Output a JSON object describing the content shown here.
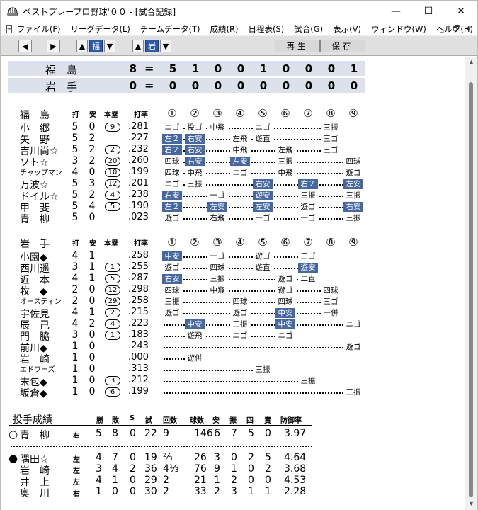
{
  "window": {
    "title": "ベストプレープロ野球'００ - [試合記録]",
    "minimize": "—",
    "maximize": "☐",
    "close": "✕"
  },
  "menu": [
    "ファイル(F)",
    "リーグデータ(L)",
    "チームデータ(T)",
    "成績(R)",
    "日程表(S)",
    "試合(G)",
    "表示(V)",
    "ウィンドウ(W)",
    "ヘルプ(H)"
  ],
  "mdi_controls": [
    "_",
    "🗗",
    "✕"
  ],
  "toolbar": {
    "prev": "◀",
    "next": "▶",
    "team1_up": "▲",
    "team1": "福",
    "team1_down": "▼",
    "team2_up": "▲",
    "team2": "岩",
    "team2_down": "▼",
    "play": "再生",
    "save": "保存"
  },
  "scoreboard": {
    "rows": [
      {
        "team": "福　島",
        "runs": "8",
        "eq": "=",
        "innings": [
          "5",
          "1",
          "0",
          "0",
          "1",
          "0",
          "0",
          "0",
          "1"
        ]
      },
      {
        "team": "岩　手",
        "runs": "0",
        "eq": "=",
        "innings": [
          "0",
          "0",
          "0",
          "0",
          "0",
          "0",
          "0",
          "0",
          "0"
        ]
      }
    ]
  },
  "batting_headers": {
    "ab": "打",
    "h": "安",
    "hr": "本塁",
    "avg": "打率",
    "innings": [
      "①",
      "②",
      "③",
      "④",
      "⑤",
      "⑥",
      "⑦",
      "⑧",
      "⑨"
    ]
  },
  "teams": [
    {
      "name": "福　島",
      "players": [
        {
          "name": "小　郷",
          "ab": "5",
          "h": "0",
          "hr": "9",
          "avg": ".281",
          "res": [
            [
              "ニゴ",
              0
            ],
            [
              "投ゴ",
              0
            ],
            [
              "中飛",
              0
            ],
            [
              "",
              0
            ],
            [
              "ニゴ",
              0
            ],
            [
              "",
              0
            ],
            [
              "",
              0
            ],
            [
              "三振",
              0
            ],
            [
              "",
              0
            ]
          ]
        },
        {
          "name": "矢　野",
          "ab": "5",
          "h": "2",
          "hr": "",
          "avg": ".227",
          "res": [
            [
              "左２",
              1
            ],
            [
              "右安",
              1
            ],
            [
              "",
              0
            ],
            [
              "左飛",
              0
            ],
            [
              "遊直",
              0
            ],
            [
              "",
              0
            ],
            [
              "",
              0
            ],
            [
              "三ゴ",
              0
            ],
            [
              "",
              0
            ]
          ]
        },
        {
          "name": "吉川尚☆",
          "ab": "5",
          "h": "2",
          "hr": "2",
          "avg": ".232",
          "res": [
            [
              "右２",
              1
            ],
            [
              "右安",
              1
            ],
            [
              "",
              0
            ],
            [
              "中飛",
              0
            ],
            [
              "",
              0
            ],
            [
              "左飛",
              0
            ],
            [
              "",
              0
            ],
            [
              "三ゴ",
              0
            ],
            [
              "",
              0
            ]
          ]
        },
        {
          "name": "ソト☆",
          "ab": "3",
          "h": "2",
          "hr": "20",
          "avg": ".260",
          "res": [
            [
              "四球",
              0
            ],
            [
              "右安",
              1
            ],
            [
              "",
              0
            ],
            [
              "左安",
              1
            ],
            [
              "",
              0
            ],
            [
              "三振",
              0
            ],
            [
              "",
              0
            ],
            [
              "",
              0
            ],
            [
              "四球",
              0
            ]
          ]
        },
        {
          "name": "チャップマン",
          "ab": "4",
          "h": "0",
          "hr": "10",
          "avg": ".199",
          "res": [
            [
              "四球",
              0
            ],
            [
              "中飛",
              0
            ],
            [
              "",
              0
            ],
            [
              "ニゴ",
              0
            ],
            [
              "",
              0
            ],
            [
              "中飛",
              0
            ],
            [
              "",
              0
            ],
            [
              "",
              0
            ],
            [
              "遊ゴ",
              0
            ]
          ]
        },
        {
          "name": "万波☆",
          "ab": "5",
          "h": "3",
          "hr": "12",
          "avg": ".201",
          "res": [
            [
              "ニゴ",
              0
            ],
            [
              "三振",
              0
            ],
            [
              "",
              0
            ],
            [
              "",
              0
            ],
            [
              "右安",
              1
            ],
            [
              "",
              0
            ],
            [
              "右２",
              1
            ],
            [
              "",
              0
            ],
            [
              "左安",
              1
            ]
          ]
        },
        {
          "name": "ドイル☆",
          "ab": "5",
          "h": "2",
          "hr": "4",
          "avg": ".238",
          "res": [
            [
              "右安",
              1
            ],
            [
              "",
              0
            ],
            [
              "一ゴ",
              0
            ],
            [
              "",
              0
            ],
            [
              "遊安",
              1
            ],
            [
              "",
              0
            ],
            [
              "三振",
              0
            ],
            [
              "",
              0
            ],
            [
              "三振",
              0
            ]
          ]
        },
        {
          "name": "甲　斐",
          "ab": "5",
          "h": "4",
          "hr": "5",
          "avg": ".190",
          "res": [
            [
              "左２",
              1
            ],
            [
              "",
              0
            ],
            [
              "左安",
              1
            ],
            [
              "",
              0
            ],
            [
              "左安",
              1
            ],
            [
              "",
              0
            ],
            [
              "遊ゴ",
              0
            ],
            [
              "",
              0
            ],
            [
              "右安",
              1
            ]
          ]
        },
        {
          "name": "青　柳",
          "ab": "5",
          "h": "0",
          "hr": "",
          "avg": ".023",
          "res": [
            [
              "遊ゴ",
              0
            ],
            [
              "",
              0
            ],
            [
              "右飛",
              0
            ],
            [
              "",
              0
            ],
            [
              "一ゴ",
              0
            ],
            [
              "",
              0
            ],
            [
              "一ゴ",
              0
            ],
            [
              "",
              0
            ],
            [
              "三振",
              0
            ]
          ]
        }
      ]
    },
    {
      "name": "岩　手",
      "players": [
        {
          "name": "小園◆",
          "ab": "4",
          "h": "1",
          "hr": "",
          "avg": ".258",
          "res": [
            [
              "中安",
              1
            ],
            [
              "",
              0
            ],
            [
              "一ゴ",
              0
            ],
            [
              "",
              0
            ],
            [
              "遊ゴ",
              0
            ],
            [
              "",
              0
            ],
            [
              "三ゴ",
              0
            ],
            [
              "",
              0
            ],
            [
              "",
              0
            ]
          ]
        },
        {
          "name": "西川遥",
          "ab": "3",
          "h": "1",
          "hr": "1",
          "avg": ".255",
          "res": [
            [
              "遊ゴ",
              0
            ],
            [
              "",
              0
            ],
            [
              "四球",
              0
            ],
            [
              "",
              0
            ],
            [
              "遊直",
              0
            ],
            [
              "",
              0
            ],
            [
              "遊安",
              1
            ],
            [
              "",
              0
            ],
            [
              "",
              0
            ]
          ]
        },
        {
          "name": "近　本",
          "ab": "4",
          "h": "1",
          "hr": "5",
          "avg": ".287",
          "res": [
            [
              "右安",
              1
            ],
            [
              "",
              0
            ],
            [
              "三振",
              0
            ],
            [
              "",
              0
            ],
            [
              "",
              0
            ],
            [
              "遊ゴ",
              0
            ],
            [
              "二直",
              0
            ],
            [
              "",
              0
            ],
            [
              "",
              0
            ]
          ]
        },
        {
          "name": "牧　◆",
          "ab": "2",
          "h": "0",
          "hr": "12",
          "avg": ".298",
          "res": [
            [
              "四球",
              0
            ],
            [
              "",
              0
            ],
            [
              "中飛",
              0
            ],
            [
              "",
              0
            ],
            [
              "",
              0
            ],
            [
              "遊ゴ",
              0
            ],
            [
              "",
              0
            ],
            [
              "四球",
              0
            ],
            [
              "",
              0
            ]
          ]
        },
        {
          "name": "オースティン",
          "ab": "2",
          "h": "0",
          "hr": "29",
          "avg": ".258",
          "res": [
            [
              "三振",
              0
            ],
            [
              "",
              0
            ],
            [
              "",
              0
            ],
            [
              "四球",
              0
            ],
            [
              "",
              0
            ],
            [
              "四球",
              0
            ],
            [
              "",
              0
            ],
            [
              "三ゴ",
              0
            ],
            [
              "",
              0
            ]
          ]
        },
        {
          "name": "宇佐見",
          "ab": "4",
          "h": "1",
          "hr": "2",
          "avg": ".215",
          "res": [
            [
              "遊ゴ",
              0
            ],
            [
              "",
              0
            ],
            [
              "",
              0
            ],
            [
              "遊ゴ",
              0
            ],
            [
              "",
              0
            ],
            [
              "中安",
              1
            ],
            [
              "",
              0
            ],
            [
              "一併",
              0
            ],
            [
              "",
              0
            ]
          ]
        },
        {
          "name": "辰　己",
          "ab": "4",
          "h": "2",
          "hr": "4",
          "avg": ".223",
          "res": [
            [
              "",
              0
            ],
            [
              "中安",
              1
            ],
            [
              "",
              0
            ],
            [
              "三振",
              0
            ],
            [
              "",
              0
            ],
            [
              "中安",
              1
            ],
            [
              "",
              0
            ],
            [
              "",
              0
            ],
            [
              "ニゴ",
              0
            ]
          ]
        },
        {
          "name": "門　脇",
          "ab": "3",
          "h": "0",
          "hr": "1",
          "avg": ".183",
          "res": [
            [
              "",
              0
            ],
            [
              "遊飛",
              0
            ],
            [
              "",
              0
            ],
            [
              "ニゴ",
              0
            ],
            [
              "",
              0
            ],
            [
              "ニゴ",
              0
            ],
            [
              "",
              0
            ],
            [
              "",
              0
            ],
            [
              "",
              0
            ]
          ]
        },
        {
          "name": "前川◆",
          "ab": "1",
          "h": "0",
          "hr": "",
          "avg": ".243",
          "res": [
            [
              "",
              0
            ],
            [
              "",
              0
            ],
            [
              "",
              0
            ],
            [
              "",
              0
            ],
            [
              "",
              0
            ],
            [
              "",
              0
            ],
            [
              "",
              0
            ],
            [
              "",
              0
            ],
            [
              "遊ゴ",
              0
            ]
          ]
        },
        {
          "name": "岩　崎",
          "ab": "1",
          "h": "0",
          "hr": "",
          "avg": ".000",
          "res": [
            [
              "",
              0
            ],
            [
              "遊併",
              0
            ],
            [
              "",
              0
            ],
            [
              "",
              0
            ],
            [
              "",
              0
            ],
            [
              "",
              0
            ],
            [
              "",
              0
            ],
            [
              "",
              0
            ],
            [
              "",
              0
            ]
          ]
        },
        {
          "name": "エドワーズ",
          "ab": "1",
          "h": "0",
          "hr": "",
          "avg": ".313",
          "res": [
            [
              "",
              0
            ],
            [
              "",
              0
            ],
            [
              "",
              0
            ],
            [
              "",
              0
            ],
            [
              "三振",
              0
            ],
            [
              "",
              0
            ],
            [
              "",
              0
            ],
            [
              "",
              0
            ],
            [
              "",
              0
            ]
          ]
        },
        {
          "name": "末包◆",
          "ab": "1",
          "h": "0",
          "hr": "3",
          "avg": ".212",
          "res": [
            [
              "",
              0
            ],
            [
              "",
              0
            ],
            [
              "",
              0
            ],
            [
              "",
              0
            ],
            [
              "",
              0
            ],
            [
              "",
              0
            ],
            [
              "三振",
              0
            ],
            [
              "",
              0
            ],
            [
              "",
              0
            ]
          ]
        },
        {
          "name": "坂倉◆",
          "ab": "1",
          "h": "0",
          "hr": "6",
          "avg": ".199",
          "res": [
            [
              "",
              0
            ],
            [
              "",
              0
            ],
            [
              "",
              0
            ],
            [
              "",
              0
            ],
            [
              "",
              0
            ],
            [
              "",
              0
            ],
            [
              "",
              0
            ],
            [
              "",
              0
            ],
            [
              "三振",
              0
            ]
          ]
        }
      ]
    }
  ],
  "pitching": {
    "title": "投手成績",
    "headers": [
      "勝",
      "敗",
      "S",
      "試",
      "回数",
      "球数",
      "安",
      "振",
      "四",
      "責",
      "防御率"
    ],
    "winner": {
      "mark": "○",
      "name": "青　柳",
      "hand": "右",
      "w": "5",
      "l": "8",
      "s": "0",
      "g": "22",
      "ip": "9",
      "pitches": "146",
      "h": "6",
      "k": "7",
      "bb": "5",
      "er": "0",
      "era": "3.97"
    },
    "losers": [
      {
        "mark": "●",
        "name": "隅田☆",
        "hand": "左",
        "w": "4",
        "l": "7",
        "s": "0",
        "g": "19",
        "ip": "⅔",
        "pitches": "26",
        "h": "3",
        "k": "0",
        "bb": "2",
        "er": "5",
        "era": "4.64"
      },
      {
        "mark": "",
        "name": "岩　崎",
        "hand": "左",
        "w": "3",
        "l": "4",
        "s": "2",
        "g": "36",
        "ip": "4⅓",
        "pitches": "76",
        "h": "9",
        "k": "1",
        "bb": "0",
        "er": "2",
        "era": "3.68"
      },
      {
        "mark": "",
        "name": "井　上",
        "hand": "左",
        "w": "4",
        "l": "1",
        "s": "0",
        "g": "29",
        "ip": "2",
        "pitches": "21",
        "h": "1",
        "k": "2",
        "bb": "0",
        "er": "0",
        "era": "4.53"
      },
      {
        "mark": "",
        "name": "奥　川",
        "hand": "右",
        "w": "1",
        "l": "0",
        "s": "0",
        "g": "30",
        "ip": "2",
        "pitches": "33",
        "h": "2",
        "k": "3",
        "bb": "1",
        "er": "1",
        "era": "2.28"
      }
    ]
  },
  "colors": {
    "hit": "#46679f",
    "scoreboard_bg": "#dce1ec",
    "selected": "#2c5aa8"
  }
}
